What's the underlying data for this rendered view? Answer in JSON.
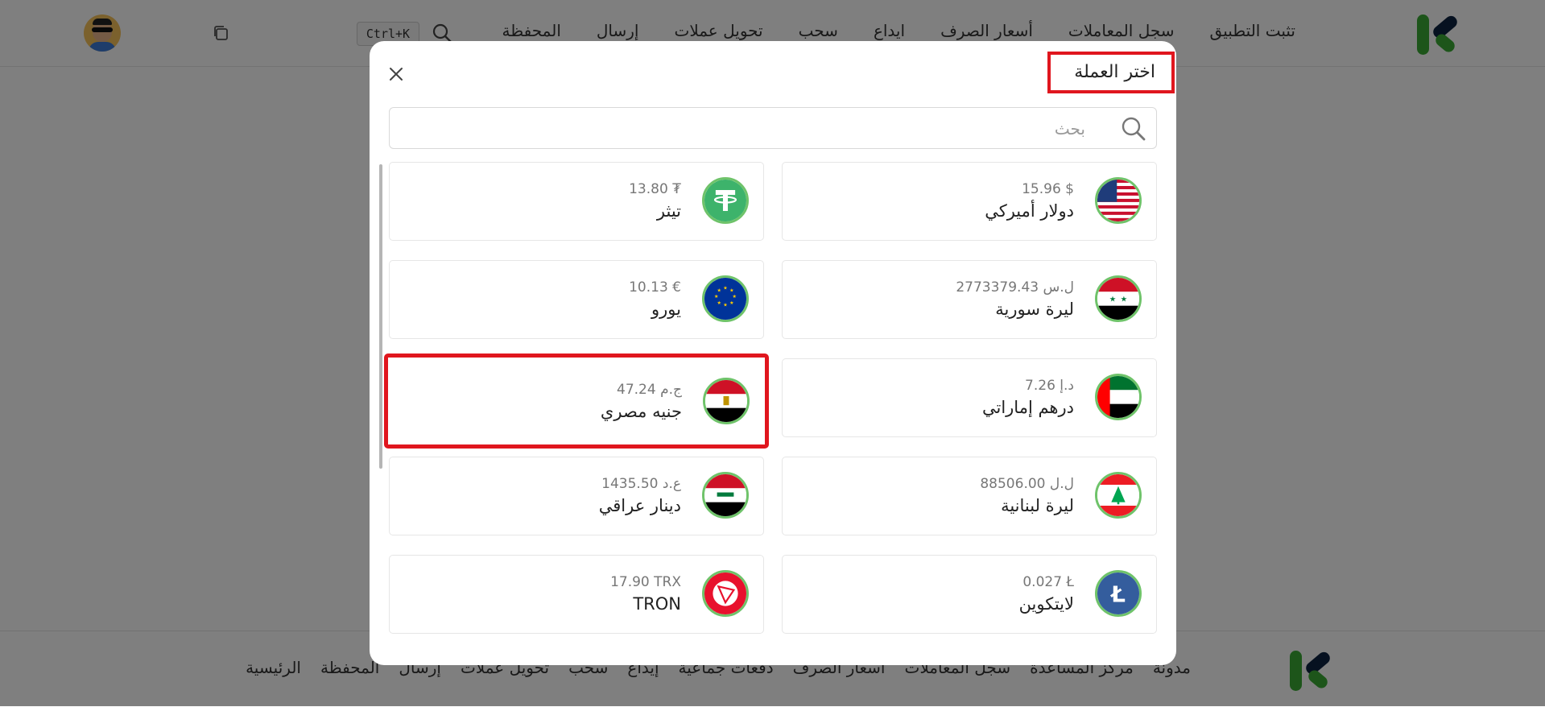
{
  "topbar": {
    "nav": [
      "المحفظة",
      "إرسال",
      "تحويل عملات",
      "سحب",
      "ايداع",
      "أسعار الصرف",
      "سجل المعاملات",
      "تثبت التطبيق"
    ],
    "shortcut": "Ctrl+K"
  },
  "footer": {
    "links": [
      "الرئيسية",
      "المحفظة",
      "إرسال",
      "تحويل عملات",
      "سحب",
      "إيداع",
      "دفعات جماعية",
      "أسعار الصرف",
      "سجل المعاملات",
      "مركز المساعدة",
      "مدونة"
    ]
  },
  "modal": {
    "title": "اختر العملة",
    "search_placeholder": "بحث",
    "currencies": [
      {
        "name": "دولار أميركي",
        "amount": "15.96 $",
        "flag": "us-flag-icon"
      },
      {
        "name": "تيثر",
        "amount": "13.80 ₮",
        "flag": "tether-icon"
      },
      {
        "name": "ليرة سورية",
        "amount": "2773379.43 ل.س",
        "flag": "syria-flag-icon"
      },
      {
        "name": "يورو",
        "amount": "10.13 €",
        "flag": "eu-flag-icon"
      },
      {
        "name": "درهم إماراتي",
        "amount": "7.26 د.إ",
        "flag": "uae-flag-icon"
      },
      {
        "name": "جنيه مصري",
        "amount": "47.24 ج.م",
        "flag": "egypt-flag-icon"
      },
      {
        "name": "ليرة لبنانية",
        "amount": "88506.00 ل.ل",
        "flag": "lebanon-flag-icon"
      },
      {
        "name": "دينار عراقي",
        "amount": "1435.50 ع.د",
        "flag": "iraq-flag-icon"
      },
      {
        "name": "لايتكوين",
        "amount": "0.027 Ł",
        "flag": "litecoin-icon"
      },
      {
        "name": "TRON",
        "amount": "17.90 TRX",
        "flag": "tron-icon"
      }
    ]
  },
  "colors": {
    "accent": "#3aaa35",
    "navy": "#0d2340",
    "highlight": "#e0161e"
  }
}
